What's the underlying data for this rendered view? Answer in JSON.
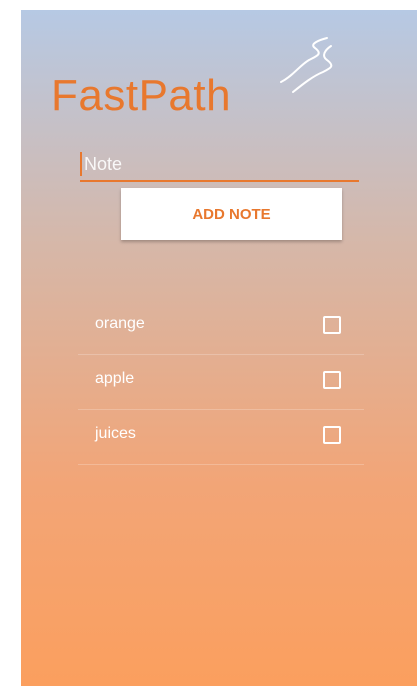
{
  "app": {
    "title": "FastPath",
    "logo_icon": "road-path-icon"
  },
  "note_input": {
    "value": "",
    "placeholder": "Note"
  },
  "add_button": {
    "label": "ADD NOTE"
  },
  "notes": [
    {
      "label": "orange",
      "checked": false
    },
    {
      "label": "apple",
      "checked": false
    },
    {
      "label": "juices",
      "checked": false
    }
  ],
  "colors": {
    "accent": "#e8782e",
    "gradient_top": "#b6c9e4",
    "gradient_bottom": "#fb9f5e"
  }
}
